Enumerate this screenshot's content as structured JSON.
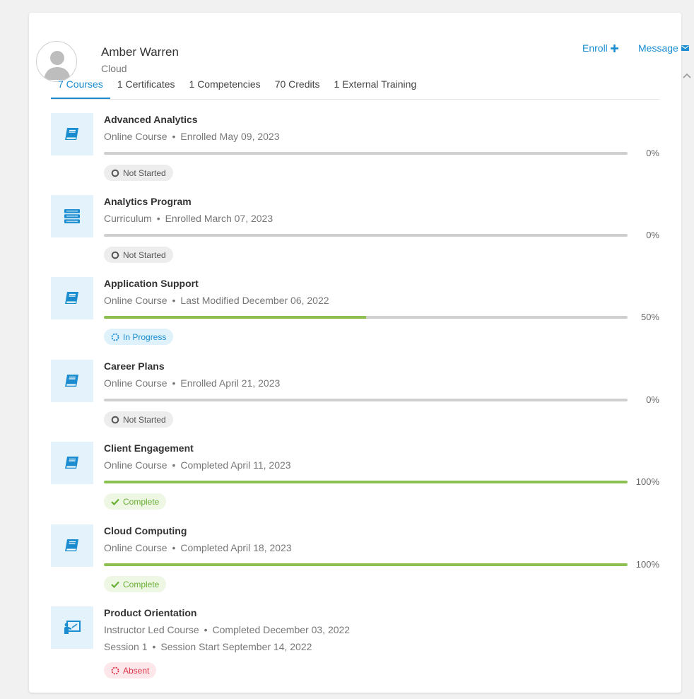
{
  "user": {
    "name": "Amber Warren",
    "subtitle": "Cloud"
  },
  "actions": {
    "enroll": "Enroll",
    "message": "Message"
  },
  "tabs": [
    {
      "label": "7 Courses",
      "active": true
    },
    {
      "label": "1 Certificates"
    },
    {
      "label": "1 Competencies"
    },
    {
      "label": "70 Credits"
    },
    {
      "label": "1 External Training"
    }
  ],
  "colors": {
    "accent": "#1a8ccf",
    "progress": "#8cc152",
    "track": "#cfcfcf",
    "absent": "#d9344a"
  },
  "courses": [
    {
      "title": "Advanced Analytics",
      "type": "Online Course",
      "detail": "Enrolled May 09, 2023",
      "progress": 0,
      "progress_label": "0%",
      "status": "Not Started",
      "icon": "book-icon"
    },
    {
      "title": "Analytics Program",
      "type": "Curriculum",
      "detail": "Enrolled March 07, 2023",
      "progress": 0,
      "progress_label": "0%",
      "status": "Not Started",
      "icon": "stack-icon"
    },
    {
      "title": "Application Support",
      "type": "Online Course",
      "detail": "Last Modified December 06, 2022",
      "progress": 50,
      "progress_label": "50%",
      "status": "In Progress",
      "icon": "book-icon"
    },
    {
      "title": "Career Plans",
      "type": "Online Course",
      "detail": "Enrolled April 21, 2023",
      "progress": 0,
      "progress_label": "0%",
      "status": "Not Started",
      "icon": "book-icon"
    },
    {
      "title": "Client Engagement",
      "type": "Online Course",
      "detail": "Completed April 11, 2023",
      "progress": 100,
      "progress_label": "100%",
      "status": "Complete",
      "icon": "book-icon"
    },
    {
      "title": "Cloud Computing",
      "type": "Online Course",
      "detail": "Completed April 18, 2023",
      "progress": 100,
      "progress_label": "100%",
      "status": "Complete",
      "icon": "book-icon"
    },
    {
      "title": "Product Orientation",
      "type": "Instructor Led Course",
      "detail": "Completed December 03, 2022",
      "session": "Session 1",
      "session_detail": "Session Start September 14, 2022",
      "status": "Absent",
      "icon": "presentation-icon"
    }
  ]
}
